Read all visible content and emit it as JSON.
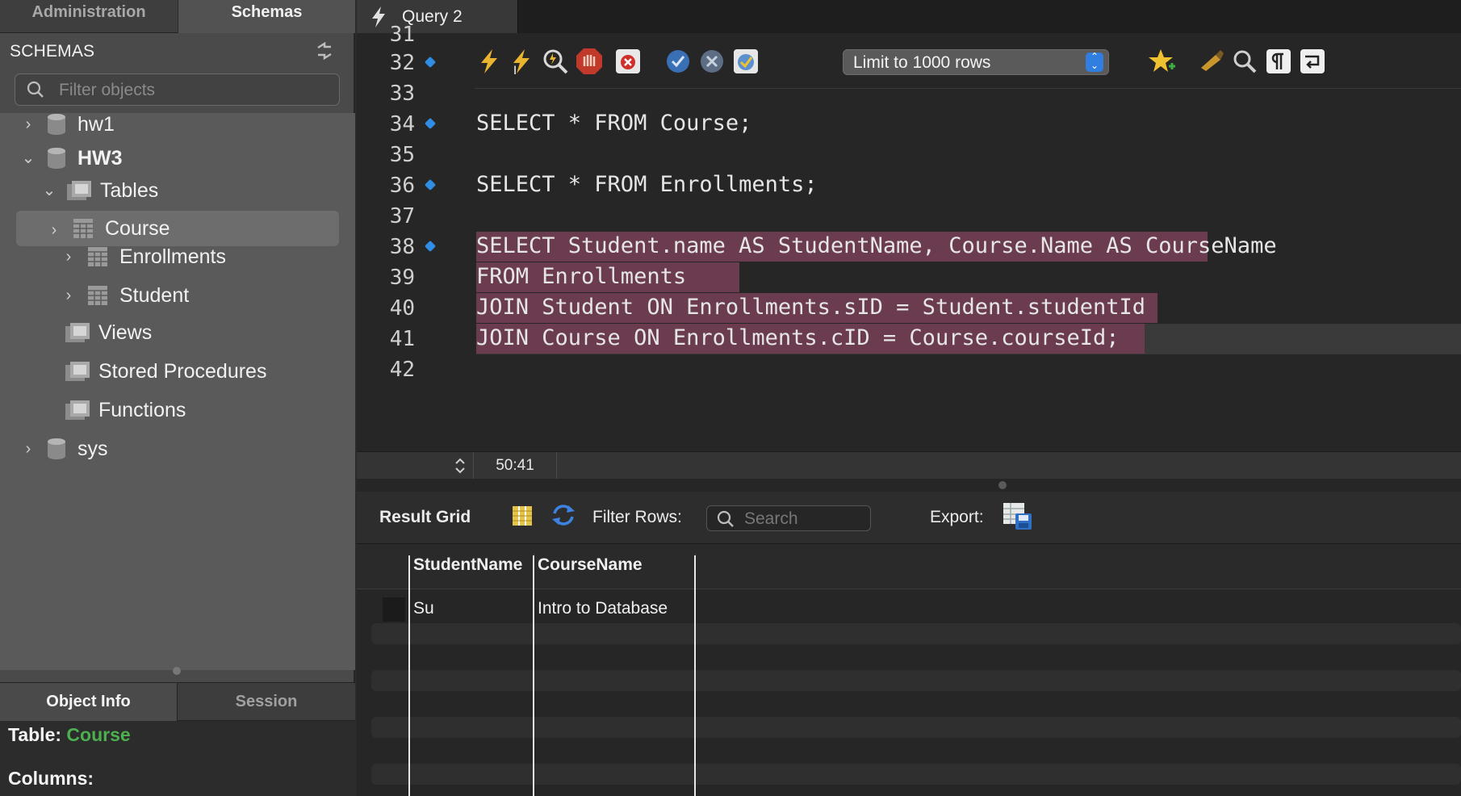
{
  "left_panel": {
    "tabs": [
      "Administration",
      "Schemas"
    ],
    "schemas_header": "SCHEMAS",
    "filter_placeholder": "Filter objects",
    "tree": [
      {
        "label": "hw1",
        "expanded": false
      },
      {
        "label": "HW3",
        "expanded": true
      },
      {
        "label": "Tables",
        "expanded": true
      },
      {
        "label": "Course",
        "expanded": false,
        "selected": true
      },
      {
        "label": "Enrollments",
        "expanded": false
      },
      {
        "label": "Student",
        "expanded": false
      },
      {
        "label": "Views"
      },
      {
        "label": "Stored Procedures"
      },
      {
        "label": "Functions"
      },
      {
        "label": "sys",
        "expanded": false
      }
    ],
    "bottom_tabs": [
      "Object Info",
      "Session"
    ],
    "info": {
      "table_label": "Table:",
      "table_name": "Course",
      "columns_label": "Columns:"
    }
  },
  "query_tab": {
    "title": "Query 2"
  },
  "editor": {
    "lines": [
      {
        "num": "31",
        "text": ""
      },
      {
        "num": "32",
        "text": "",
        "bullet": true
      },
      {
        "num": "33",
        "text": ""
      },
      {
        "num": "34",
        "text": "SELECT * FROM Course;",
        "bullet": true
      },
      {
        "num": "35",
        "text": ""
      },
      {
        "num": "36",
        "text": "SELECT * FROM Enrollments;",
        "bullet": true
      },
      {
        "num": "37",
        "text": ""
      },
      {
        "num": "38",
        "text": "SELECT Student.name AS StudentName, Course.Name AS CourseName",
        "bullet": true
      },
      {
        "num": "39",
        "text": "FROM Enrollments"
      },
      {
        "num": "40",
        "text": "JOIN Student ON Enrollments.sID = Student.studentId"
      },
      {
        "num": "41",
        "text": "JOIN Course ON Enrollments.cID = Course.courseId;"
      },
      {
        "num": "42",
        "text": ""
      }
    ],
    "limit_label": "Limit to 1000 rows",
    "cursor_position": "50:41"
  },
  "toolbar_icons": [
    "execute-icon",
    "execute-current-icon",
    "explain-icon",
    "stop-icon",
    "stop-on-error-icon",
    "commit-icon",
    "rollback-icon",
    "autocommit-icon",
    "limit-rows-select",
    "bookmark-icon",
    "beautify-icon",
    "find-icon",
    "invisible-chars-icon",
    "wrap-icon"
  ],
  "result": {
    "title": "Result Grid",
    "filter_label": "Filter Rows:",
    "search_placeholder": "Search",
    "export_label": "Export:",
    "columns": [
      "StudentName",
      "CourseName"
    ],
    "rows": [
      [
        "Su",
        "Intro to Database"
      ]
    ]
  },
  "colors": {
    "selection": "#6b3c4f",
    "keyword": "#c9b3c0",
    "accent_blue": "#2f8de4",
    "table_name_green": "#4caf50"
  }
}
